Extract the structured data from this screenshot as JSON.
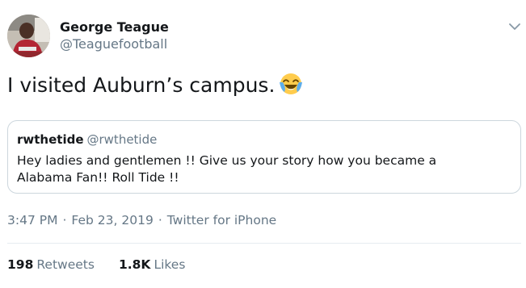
{
  "author": {
    "name": "George Teague",
    "handle": "@Teaguefootball"
  },
  "tweet": {
    "text": "I visited Auburn’s campus.",
    "emoji": "face-with-tears-of-joy"
  },
  "quoted_tweet": {
    "name": "rwthetide",
    "handle": "@rwthetide",
    "text": "Hey ladies and gentlemen !!  Give us your story how you became a\nAlabama Fan!! Roll Tide !!"
  },
  "meta": {
    "time": "3:47 PM",
    "separator": "·",
    "date": "Feb 23, 2019",
    "source": "Twitter for iPhone"
  },
  "stats": {
    "retweets_count": "198",
    "retweets_label": "Retweets",
    "likes_count": "1.8K",
    "likes_label": "Likes"
  },
  "colors": {
    "text_primary": "#14171a",
    "text_secondary": "#657786",
    "border": "#ccd6dd"
  }
}
